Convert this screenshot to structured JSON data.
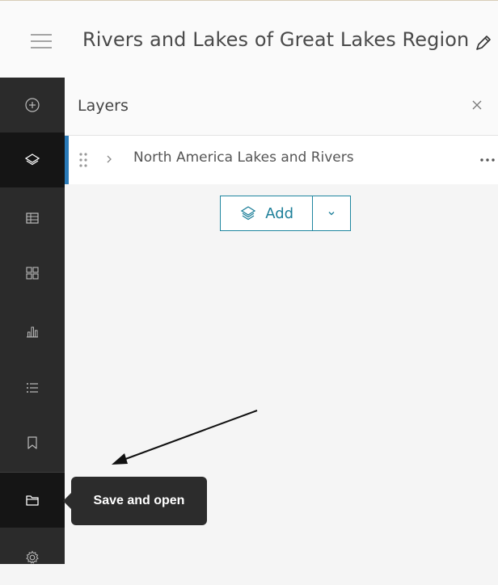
{
  "header": {
    "menu_icon": "hamburger-icon",
    "title": "Rivers and Lakes of Great Lakes Region",
    "edit_icon": "pencil-icon"
  },
  "rail": {
    "items": [
      {
        "icon": "add-circle-icon"
      },
      {
        "icon": "layers-icon",
        "active": true
      },
      {
        "icon": "table-icon"
      },
      {
        "icon": "widgets-icon"
      },
      {
        "icon": "chart-icon"
      },
      {
        "icon": "legend-icon"
      },
      {
        "icon": "bookmark-icon"
      },
      {
        "icon": "folder-icon"
      },
      {
        "icon": "gear-icon"
      }
    ]
  },
  "panel": {
    "title": "Layers",
    "close_icon": "close-icon",
    "layers": [
      {
        "name": "North America Lakes and Rivers"
      }
    ],
    "add_label": "Add"
  },
  "tooltip": {
    "text": "Save and open"
  },
  "colors": {
    "accent": "#1f86a0",
    "rail_bg": "#2b2b2b",
    "rail_active": "#151515",
    "layer_marker": "#2a7ab8",
    "tooltip_bg": "#2c2c2c"
  }
}
